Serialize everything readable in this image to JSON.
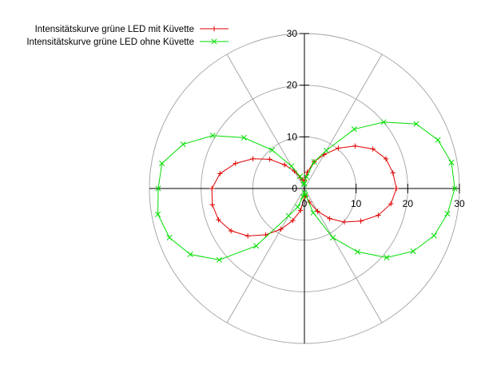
{
  "chart_data": {
    "type": "line",
    "subtype": "polar",
    "angle_unit": "degrees",
    "r_range": [
      0,
      30
    ],
    "r_tick_step": 10,
    "grid": true,
    "grid_spoke_step_deg": 60,
    "legend_position": "top-left",
    "y_tick_labels": [
      "30",
      "20",
      "10",
      "0"
    ],
    "x_tick_labels": [
      "0",
      "10",
      "20",
      "30"
    ],
    "series": [
      {
        "name": "Intensitätskurve grüne LED mit Küvette",
        "color": "#e00000",
        "marker": "plus",
        "points": [
          [
            0,
            17.8
          ],
          [
            10,
            17.4
          ],
          [
            20,
            16.8
          ],
          [
            30,
            15.3
          ],
          [
            40,
            12.8
          ],
          [
            50,
            10.2
          ],
          [
            60,
            7.6
          ],
          [
            70,
            5.5
          ],
          [
            80,
            3.2
          ],
          [
            90,
            1.6
          ],
          [
            100,
            1.6
          ],
          [
            110,
            2.2
          ],
          [
            120,
            3.9
          ],
          [
            130,
            6.0
          ],
          [
            140,
            8.8
          ],
          [
            150,
            11.5
          ],
          [
            160,
            14.2
          ],
          [
            170,
            16.6
          ],
          [
            180,
            17.9
          ],
          [
            190,
            18.1
          ],
          [
            200,
            17.7
          ],
          [
            210,
            16.4
          ],
          [
            220,
            14.3
          ],
          [
            230,
            11.7
          ],
          [
            240,
            9.1
          ],
          [
            250,
            6.6
          ],
          [
            260,
            4.3
          ],
          [
            270,
            1.6
          ],
          [
            280,
            1.4
          ],
          [
            290,
            2.8
          ],
          [
            300,
            5.1
          ],
          [
            310,
            7.6
          ],
          [
            320,
            10.1
          ],
          [
            330,
            12.6
          ],
          [
            340,
            15.2
          ],
          [
            350,
            17.0
          ]
        ]
      },
      {
        "name": "Intensitätskurve grüne LED ohne Küvette",
        "color": "#00dd00",
        "marker": "cross",
        "points": [
          [
            0,
            29.1
          ],
          [
            10,
            28.9
          ],
          [
            20,
            27.5
          ],
          [
            30,
            25.0
          ],
          [
            40,
            20.0
          ],
          [
            50,
            15.0
          ],
          [
            60,
            8.5
          ],
          [
            70,
            5.5
          ],
          [
            80,
            2.3
          ],
          [
            90,
            1.0
          ],
          [
            100,
            0.8
          ],
          [
            110,
            2.5
          ],
          [
            120,
            5.0
          ],
          [
            130,
            9.7
          ],
          [
            140,
            15.3
          ],
          [
            150,
            20.5
          ],
          [
            160,
            25.0
          ],
          [
            170,
            28.0
          ],
          [
            180,
            28.3
          ],
          [
            190,
            28.8
          ],
          [
            200,
            27.8
          ],
          [
            210,
            25.5
          ],
          [
            220,
            21.5
          ],
          [
            230,
            14.5
          ],
          [
            240,
            6.1
          ],
          [
            250,
            3.8
          ],
          [
            260,
            1.6
          ],
          [
            270,
            0.8
          ],
          [
            280,
            1.2
          ],
          [
            290,
            5.0
          ],
          [
            300,
            11.0
          ],
          [
            310,
            16.0
          ],
          [
            320,
            20.8
          ],
          [
            330,
            24.3
          ],
          [
            340,
            26.7
          ],
          [
            350,
            28.1
          ]
        ]
      }
    ]
  }
}
